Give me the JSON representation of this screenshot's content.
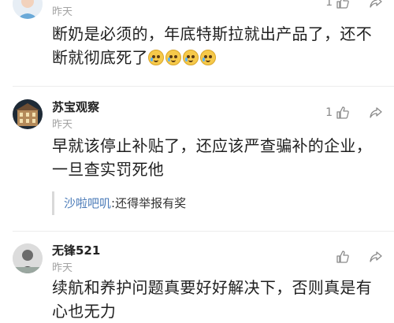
{
  "comments": [
    {
      "username": "",
      "time": "昨天",
      "likes": "1",
      "text_line1": "断奶是必须的，年底特斯拉就出产品了，还不",
      "text_line2": "断就彻底死了",
      "emoji_count": 4
    },
    {
      "username": "苏宝观察",
      "time": "昨天",
      "likes": "1",
      "text_line1": "早就该停止补贴了，还应该严查骗补的企业，",
      "text_line2": "一旦查实罚死他",
      "reply": {
        "user": "沙啦吧叽",
        "text": ":还得举报有奖"
      }
    },
    {
      "username": "无锋521",
      "time": "昨天",
      "likes": "",
      "text_line1": "续航和养护问题真要好好解决下，否则真是有",
      "text_line2": "心也无力"
    }
  ],
  "colors": {
    "time": "#a3a3a3",
    "reply_user": "#4b7bb8",
    "divider": "#ececec"
  }
}
